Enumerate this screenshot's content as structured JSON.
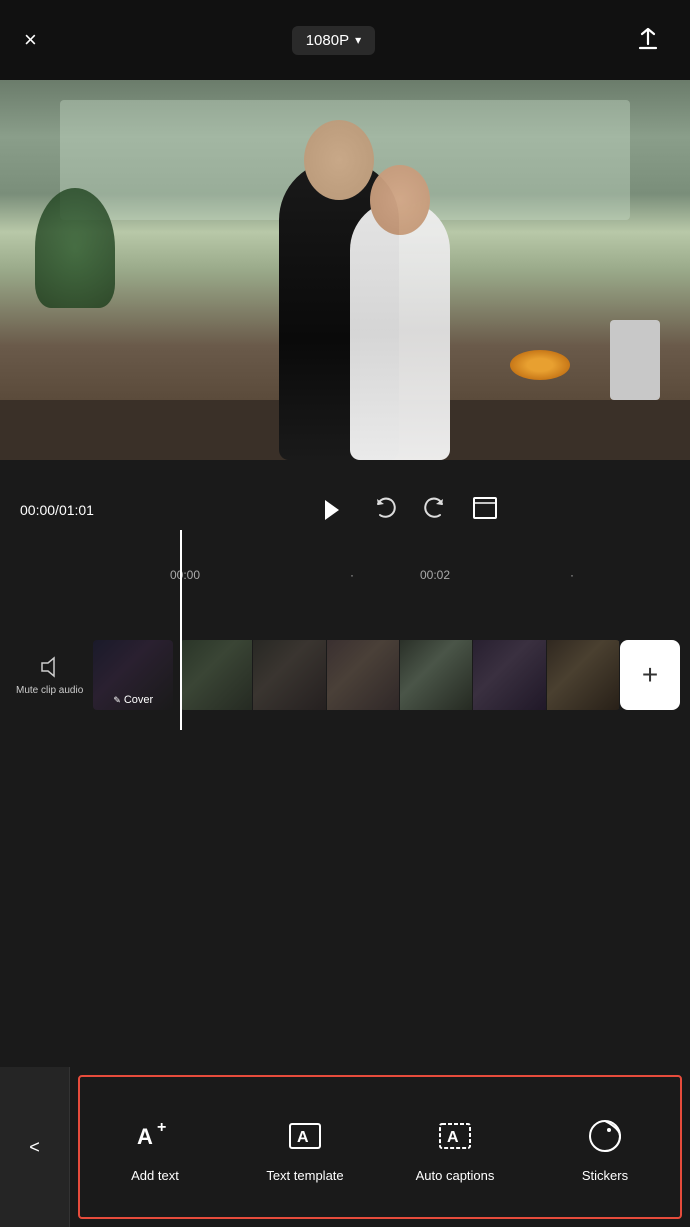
{
  "header": {
    "close_label": "×",
    "quality": "1080P",
    "dropdown_icon": "▾",
    "export_icon": "↑"
  },
  "controls": {
    "time_current": "00:00",
    "time_total": "01:01",
    "time_separator": "/",
    "play_icon": "play",
    "undo_icon": "undo",
    "redo_icon": "redo",
    "fullscreen_icon": "fullscreen"
  },
  "timeline": {
    "ruler_label_0": "00:00",
    "ruler_label_2": "00:02",
    "mute_label": "Mute clip\naudio",
    "cover_label": "Cover",
    "add_icon": "+"
  },
  "toolbar": {
    "back_label": "<",
    "tools": [
      {
        "id": "add-text",
        "icon": "add-text-icon",
        "label": "Add text"
      },
      {
        "id": "text-template",
        "icon": "text-template-icon",
        "label": "Text template"
      },
      {
        "id": "auto-captions",
        "icon": "auto-captions-icon",
        "label": "Auto captions"
      },
      {
        "id": "stickers",
        "icon": "stickers-icon",
        "label": "Stickers"
      }
    ]
  }
}
